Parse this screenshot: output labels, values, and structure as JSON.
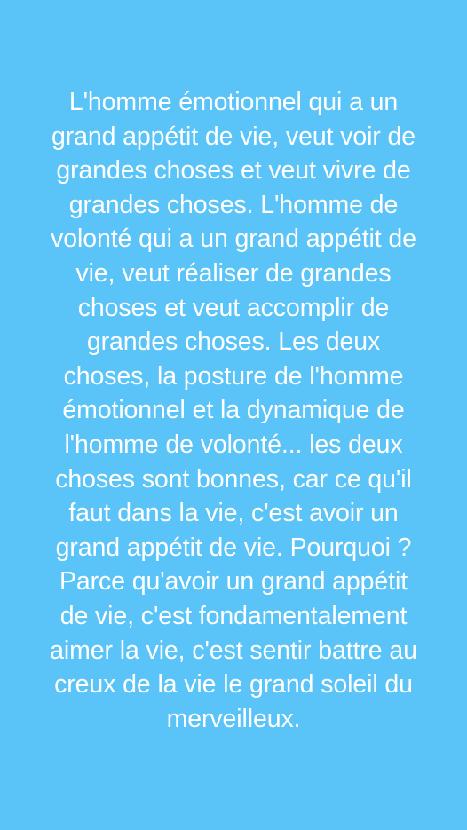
{
  "background_color": "#5ac4f8",
  "text_color": "#ffffff",
  "quote": {
    "lines": [
      "L'homme émotionnel qui a un",
      "grand appétit de vie, veut voir de",
      "grandes choses et veut vivre de",
      "grandes choses. L'homme de",
      "volonté qui a un grand appétit de",
      "vie, veut réaliser de grandes",
      "choses et veut accomplir de",
      "grandes choses. Les deux",
      "choses, la posture de l'homme",
      "émotionnel et la dynamique de",
      "l'homme de volonté... les deux",
      "choses sont bonnes, car ce qu'il",
      "faut dans la vie, c'est avoir un",
      "grand appétit de vie. Pourquoi ?",
      "Parce qu'avoir un grand appétit",
      "de vie, c'est fondamentalement",
      "aimer la vie, c'est sentir battre au",
      "creux de la vie le grand soleil du",
      "merveilleux."
    ]
  }
}
